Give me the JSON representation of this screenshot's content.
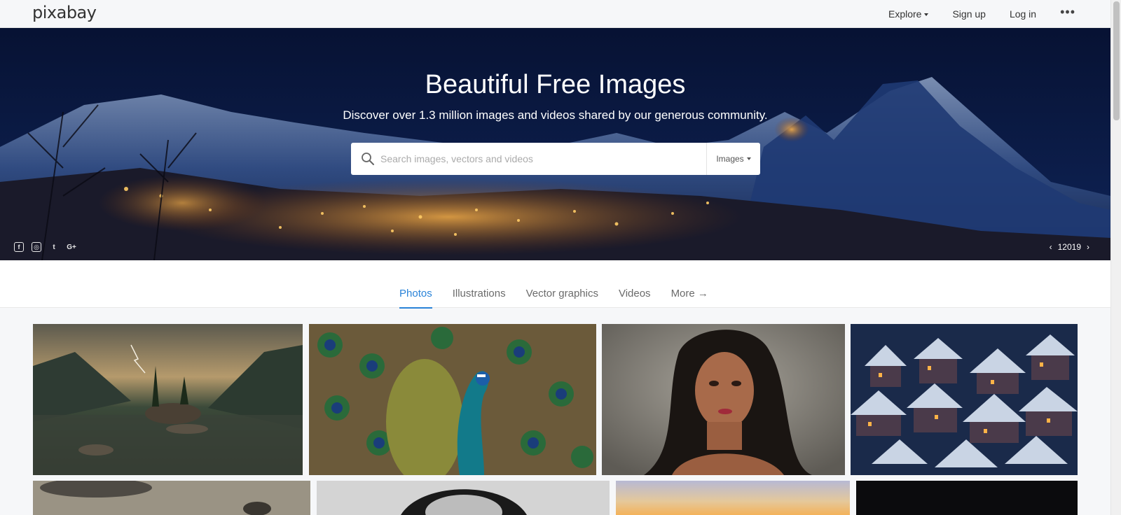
{
  "header": {
    "logo": "pixabay",
    "nav": {
      "explore": "Explore",
      "signup": "Sign up",
      "login": "Log in",
      "more": "•••"
    }
  },
  "hero": {
    "title": "Beautiful Free Images",
    "subtitle": "Discover over 1.3 million images and videos shared by our generous community.",
    "search": {
      "placeholder": "Search images, vectors and videos",
      "value": "",
      "type": "Images"
    },
    "social": {
      "facebook": "f",
      "instagram": "◎",
      "twitter": "t",
      "googleplus": "G+"
    },
    "credit": {
      "prev": "‹",
      "label": "12019",
      "next": "›"
    }
  },
  "tabs": [
    {
      "label": "Photos",
      "active": true
    },
    {
      "label": "Illustrations",
      "active": false
    },
    {
      "label": "Vector graphics",
      "active": false
    },
    {
      "label": "Videos",
      "active": false
    },
    {
      "label": "More →",
      "active": false
    }
  ],
  "colors": {
    "accent": "#2a83d8",
    "nav_text": "#333333"
  },
  "images": [
    {
      "subject": "mountain lake with lightning"
    },
    {
      "subject": "peacock"
    },
    {
      "subject": "woman portrait"
    },
    {
      "subject": "snowy village at night"
    },
    {
      "subject": "cloudy landscape"
    },
    {
      "subject": "black and white portrait"
    },
    {
      "subject": "sunset sky"
    },
    {
      "subject": "dark night scene"
    }
  ]
}
